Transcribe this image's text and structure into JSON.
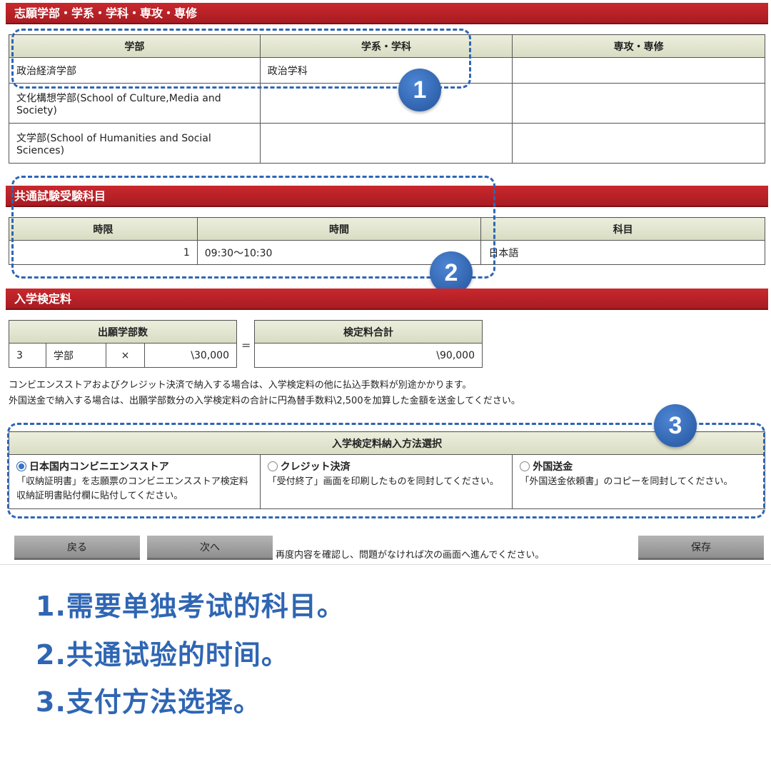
{
  "sections": {
    "faculty_title": "志願学部・学系・学科・専攻・専修",
    "common_test_title": "共通試験受験科目",
    "fee_title": "入学検定料"
  },
  "faculty_table": {
    "headers": [
      "学部",
      "学系・学科",
      "専攻・専修"
    ],
    "rows": [
      [
        "政治経済学部",
        "政治学科",
        ""
      ],
      [
        "文化構想学部(School of Culture,Media and Society)",
        "",
        ""
      ],
      [
        "文学部(School of Humanities and Social Sciences)",
        "",
        ""
      ]
    ]
  },
  "common_test": {
    "headers": [
      "時限",
      "時間",
      "科目"
    ],
    "row": {
      "period": "1",
      "time": "09:30〜10:30",
      "subject": "日本語"
    }
  },
  "fee": {
    "count_header": "出願学部数",
    "count": "3",
    "unit": "学部",
    "times": "×",
    "unit_price": "\\30,000",
    "equals": "=",
    "total_header": "検定料合計",
    "total": "\\90,000"
  },
  "notes": {
    "line1": "コンビエンスストアおよびクレジット決済で納入する場合は、入学検定料の他に払込手数料が別途かかります。",
    "line2": "外国送金で納入する場合は、出願学部数分の入学検定料の合計に円為替手数料\\2,500を加算した金額を送金してください。"
  },
  "payment": {
    "header": "入学検定料納入方法選択",
    "options": [
      {
        "label": "日本国内コンビニエンスストア",
        "selected": true,
        "desc": "「収納証明書」を志願票のコンビニエンスストア検定料収納証明書貼付欄に貼付してください。"
      },
      {
        "label": "クレジット決済",
        "selected": false,
        "desc": "「受付終了」画面を印刷したものを同封してください。"
      },
      {
        "label": "外国送金",
        "selected": false,
        "desc": "「外国送金依頼書」のコピーを同封してください。"
      }
    ]
  },
  "buttons": {
    "back": "戻る",
    "next": "次へ",
    "save": "保存",
    "hint": "再度内容を確認し、問題がなければ次の画面へ進んでください。"
  },
  "badges": [
    "1",
    "2",
    "3"
  ],
  "annotations": [
    "1.需要单独考试的科目。",
    "2.共通试验的时间。",
    "3.支付方法选择。"
  ],
  "colors": {
    "header_red": "#c9282d",
    "annotation_blue": "#2f66b3"
  }
}
